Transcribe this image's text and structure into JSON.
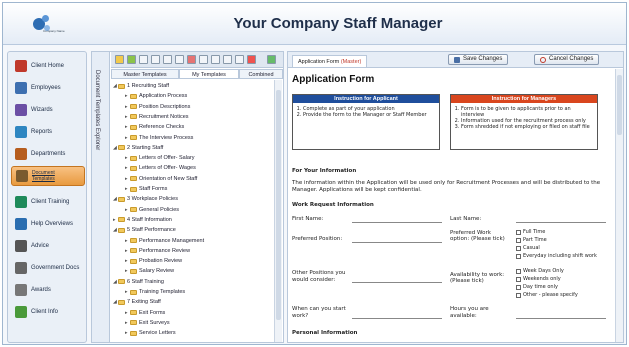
{
  "app": {
    "title": "Your Company Staff Manager",
    "logo_text": "Company Name"
  },
  "sidebar": {
    "items": [
      {
        "label": "Client Home",
        "icon": "house-icon",
        "color": "#c0392b"
      },
      {
        "label": "Employees",
        "icon": "people-icon",
        "color": "#3d6fb0"
      },
      {
        "label": "Wizards",
        "icon": "wizard-icon",
        "color": "#6b4fa5"
      },
      {
        "label": "Reports",
        "icon": "reports-icon",
        "color": "#2e86c1"
      },
      {
        "label": "Departments",
        "icon": "org-chart-icon",
        "color": "#b65d1e"
      },
      {
        "label": "Document Templates",
        "icon": "document-icon",
        "color": "#7a5a2e",
        "active": true
      },
      {
        "label": "Client Training",
        "icon": "training-icon",
        "color": "#1e8a5a"
      },
      {
        "label": "Help Overviews",
        "icon": "help-icon",
        "color": "#2a6db0"
      },
      {
        "label": "Advice",
        "icon": "advice-icon",
        "color": "#555555"
      },
      {
        "label": "Government Docs",
        "icon": "government-icon",
        "color": "#666666"
      },
      {
        "label": "Awards",
        "icon": "awards-icon",
        "color": "#777777"
      },
      {
        "label": "Client Info",
        "icon": "client-info-icon",
        "color": "#4a9a3a"
      }
    ]
  },
  "tree_panel": {
    "vertical_tab": "Document Templates Explorer",
    "tabs": {
      "master": "Master Templates",
      "mine": "My Templates",
      "combined": "Combined"
    },
    "rows": [
      {
        "label": "1 Recruiting Staff",
        "level": 0,
        "open": true
      },
      {
        "label": "Application Process",
        "level": 1
      },
      {
        "label": "Position Descriptions",
        "level": 1
      },
      {
        "label": "Recruitment Notices",
        "level": 1
      },
      {
        "label": "Reference Checks",
        "level": 1
      },
      {
        "label": "The Interview Process",
        "level": 1
      },
      {
        "label": "2 Starting Staff",
        "level": 0,
        "open": true
      },
      {
        "label": "Letters of Offer- Salary",
        "level": 1
      },
      {
        "label": "Letters of Offer- Wages",
        "level": 1
      },
      {
        "label": "Orientation of New Staff",
        "level": 1
      },
      {
        "label": "Staff Forms",
        "level": 1
      },
      {
        "label": "3 Workplace Policies",
        "level": 0,
        "open": true
      },
      {
        "label": "General Policies",
        "level": 1
      },
      {
        "label": "4 Staff Information",
        "level": 0,
        "open": false
      },
      {
        "label": "5 Staff Performance",
        "level": 0,
        "open": true
      },
      {
        "label": "Performance Management",
        "level": 1
      },
      {
        "label": "Performance Review",
        "level": 1
      },
      {
        "label": "Probation Review",
        "level": 1
      },
      {
        "label": "Salary Review",
        "level": 1
      },
      {
        "label": "6 Staff Training",
        "level": 0,
        "open": true
      },
      {
        "label": "Training Templates",
        "level": 1
      },
      {
        "label": "7 Exiting Staff",
        "level": 0,
        "open": true
      },
      {
        "label": "Exit Forms",
        "level": 1
      },
      {
        "label": "Exit Surveys",
        "level": 1
      },
      {
        "label": "Service Letters",
        "level": 1
      }
    ]
  },
  "content": {
    "tab_label": "Application Form",
    "tab_suffix": "(Master)",
    "save_label": "Save Changes",
    "cancel_label": "Cancel Changes"
  },
  "form": {
    "title": "Application Form",
    "applicant_box": {
      "heading": "Instruction for Applicant",
      "color": "#1f4e9c",
      "items": [
        "Complete as part of your application",
        "Provide the form to the Manager or Staff Member"
      ]
    },
    "manager_box": {
      "heading": "Instruction for Managers",
      "color": "#d9461e",
      "items": [
        "Form is to be given to applicants prior to an interview",
        "Information used for the recruitment process only",
        "Form shredded if not employing or filed on staff file"
      ]
    },
    "your_info_heading": "For Your Information",
    "your_info_text": "The information within the Application will be used only for Recruitment Processes and will be distributed to the Manager. Applications will be kept confidential.",
    "work_request_heading": "Work Request Information",
    "first_name": "First Name:",
    "last_name": "Last Name:",
    "preferred_position": "Preferred Position:",
    "preferred_work_option": "Preferred Work option: (Please tick)",
    "work_options": [
      "Full Time",
      "Part Time",
      "Casual",
      "Everyday including shift work"
    ],
    "other_positions": "Other Positions you would consider:",
    "availability": "Availability to work: (Please tick)",
    "availability_options": [
      "Week Days Only",
      "Weekends only",
      "Day time only",
      "Other - please specify"
    ],
    "start_work": "When can you start work?",
    "hours_available": "Hours you are available:",
    "personal_info_heading": "Personal Information"
  }
}
